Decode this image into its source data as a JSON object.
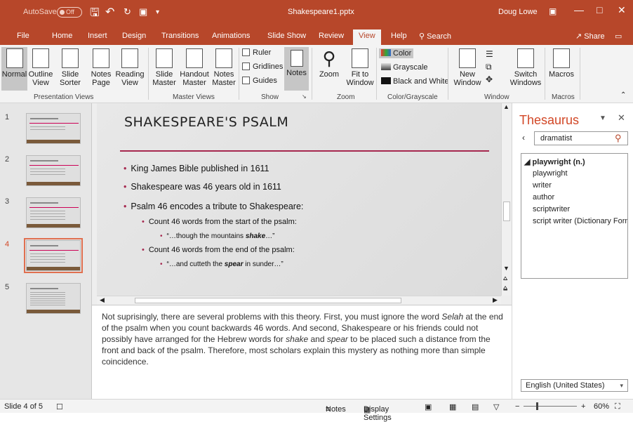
{
  "titlebar": {
    "autosave_label": "AutoSave",
    "autosave_state": "Off",
    "document_title": "Shakespeare1.pptx",
    "user_name": "Doug Lowe"
  },
  "tabs": [
    "File",
    "Home",
    "Insert",
    "Design",
    "Transitions",
    "Animations",
    "Slide Show",
    "Review",
    "View",
    "Help"
  ],
  "search_label": "Search",
  "share_label": "Share",
  "ribbon": {
    "presentation_views": {
      "label": "Presentation Views",
      "normal": "Normal",
      "outline_view": [
        "Outline",
        "View"
      ],
      "slide_sorter": [
        "Slide",
        "Sorter"
      ],
      "notes_page": [
        "Notes",
        "Page"
      ],
      "reading_view": [
        "Reading",
        "View"
      ]
    },
    "master_views": {
      "label": "Master Views",
      "slide_master": [
        "Slide",
        "Master"
      ],
      "handout_master": [
        "Handout",
        "Master"
      ],
      "notes_master": [
        "Notes",
        "Master"
      ]
    },
    "show": {
      "label": "Show",
      "ruler": "Ruler",
      "gridlines": "Gridlines",
      "guides": "Guides",
      "notes": "Notes"
    },
    "zoom": {
      "label": "Zoom",
      "zoom": "Zoom",
      "fit_to_window": [
        "Fit to",
        "Window"
      ]
    },
    "color_grayscale": {
      "label": "Color/Grayscale",
      "color": "Color",
      "grayscale": "Grayscale",
      "black_and_white": "Black and White"
    },
    "window": {
      "label": "Window",
      "new_window": [
        "New",
        "Window"
      ],
      "switch_windows": [
        "Switch",
        "Windows"
      ]
    },
    "macros": {
      "label": "Macros",
      "macros": "Macros"
    }
  },
  "thumbnails": [
    {
      "num": "1",
      "selected": false
    },
    {
      "num": "2",
      "selected": false
    },
    {
      "num": "3",
      "selected": false
    },
    {
      "num": "4",
      "selected": true
    },
    {
      "num": "5",
      "selected": false
    }
  ],
  "slide": {
    "title": "SHAKESPEARE'S PSALM",
    "bullets": [
      "King James Bible published in 1611",
      "Shakespeare was 46 years old in 1611",
      "Psalm 46 encodes a tribute to Shakespeare:"
    ],
    "sub1": "Count 46 words from the start of the psalm:",
    "quote1_pre": "“…though the mountains ",
    "quote1_em": "shake",
    "quote1_post": "…”",
    "sub2": "Count 46 words from the end of the psalm:",
    "quote2_pre": "“…and cutteth the ",
    "quote2_em": "spear",
    "quote2_post": " in sunder…”"
  },
  "notes": {
    "p1": "Not suprisingly, there are several problems with this theory. First, you must ignore the word ",
    "em1": "Selah",
    "p2": " at the end of the psalm when you count backwards 46 words. And second, Shakespeare or his friends could not possibly have arranged for the Hebrew words for ",
    "em2": "shake",
    "p3": " and ",
    "em3": "spear",
    "p4": " to be placed such a distance from the front and back of the psalm. Therefore, most scholars explain this mystery as nothing more than simple coincidence."
  },
  "thesaurus": {
    "title": "Thesaurus",
    "search_value": "dramatist",
    "heading": "playwright (n.)",
    "items": [
      "playwright",
      "writer",
      "author",
      "scriptwriter",
      "script writer (Dictionary Form)"
    ],
    "language": "English (United States)"
  },
  "statusbar": {
    "slide_info": "Slide 4 of 5",
    "notes": "Notes",
    "display_settings": "Display Settings",
    "zoom_level": "60%"
  },
  "colors": {
    "accent": "#b7472a",
    "slide_rule": "#a6284f"
  }
}
